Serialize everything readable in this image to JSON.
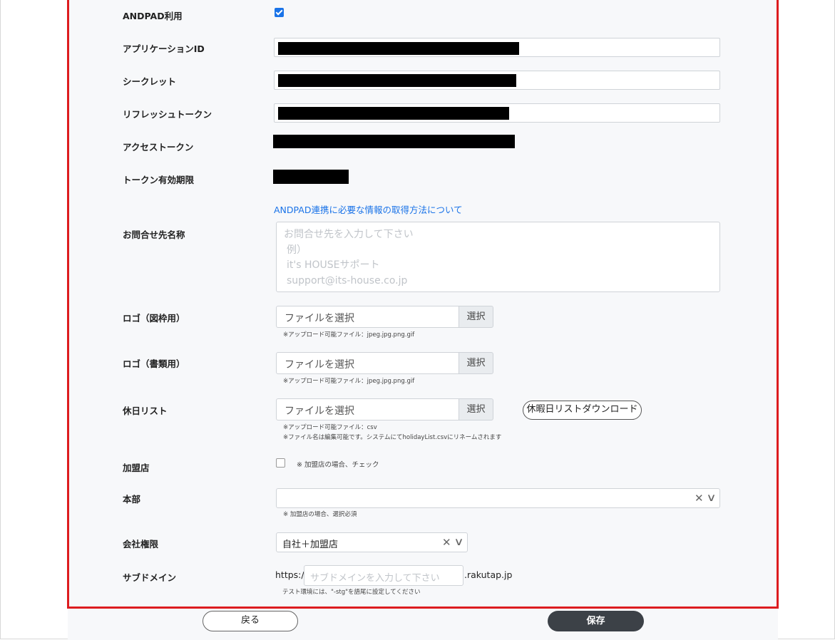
{
  "form": {
    "andpad_use_label": "ANDPAD利用",
    "andpad_use_checked": true,
    "app_id_label": "アプリケーションID",
    "secret_label": "シークレット",
    "refresh_token_label": "リフレッシュトークン",
    "access_token_label": "アクセストークン",
    "token_expiry_label": "トークン有効期限",
    "andpad_help_link": "ANDPAD連携に必要な情報の取得方法について",
    "contact_name_label": "お問合せ先名称",
    "contact_placeholder_lines": [
      "お問合せ先を入力して下さい",
      " 例）",
      " it's HOUSEサポート",
      " support@its-house.co.jp"
    ],
    "logo_frame_label": "ロゴ（図枠用）",
    "logo_docs_label": "ロゴ（書類用）",
    "holiday_list_label": "休日リスト",
    "file_placeholder": "ファイルを選択",
    "select_button": "選択",
    "image_upload_note": "※アップロード可能ファイル：jpeg.jpg.png.gif",
    "csv_upload_note": "※アップロード可能ファイル：csv",
    "rename_note": "※ファイル名は編集可能です。システムにてholidayList.csvにリネームされます",
    "holiday_download_button": "休暇日リストダウンロード",
    "franchise_label": "加盟店",
    "franchise_note": "※ 加盟店の場合、チェック",
    "franchise_checked": false,
    "hq_label": "本部",
    "hq_value": "",
    "hq_note": "※ 加盟店の場合、選択必須",
    "company_auth_label": "会社権限",
    "company_auth_value": "自社＋加盟店",
    "subdomain_label": "サブドメイン",
    "subdomain_prefix": "https://",
    "subdomain_placeholder": "サブドメインを入力して下さい",
    "subdomain_suffix": ".rakutap.jp",
    "subdomain_note": "テスト環境には、\"-stg\"を語尾に設定してください"
  },
  "footer": {
    "back_button": "戻る",
    "save_button": "保存"
  },
  "icons": {
    "clear": "✕",
    "chevron": "∨"
  },
  "colors": {
    "highlight_border": "#dd1c1f",
    "link": "#1a73e8",
    "save_button_bg": "#3c4147"
  }
}
